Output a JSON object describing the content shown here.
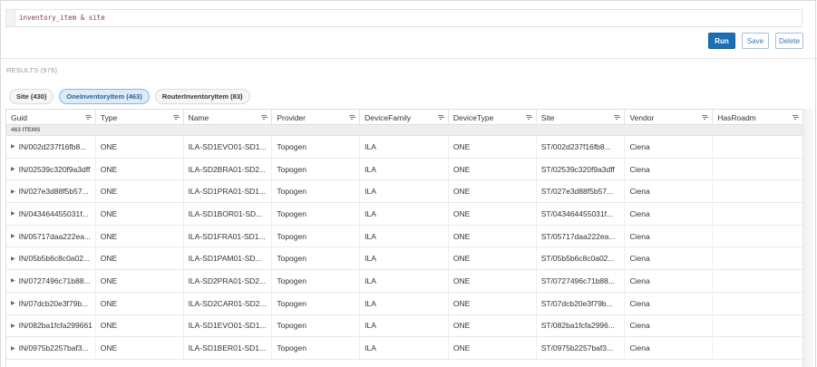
{
  "query": {
    "text": "inventory_item & site"
  },
  "buttons": {
    "run": "Run",
    "save": "Save",
    "delete": "Delete"
  },
  "results_label": "RESULTS (976)",
  "tabs": [
    {
      "label": "Site (430)",
      "active": false
    },
    {
      "label": "OneInventoryItem (463)",
      "active": true
    },
    {
      "label": "RouterInventoryItem (83)",
      "active": false
    }
  ],
  "columns": [
    "Guid",
    "Type",
    "Name",
    "Provider",
    "DeviceFamily",
    "DeviceType",
    "Site",
    "Vendor",
    "HasRoadm"
  ],
  "group_label": "463 ITEMS",
  "rows": [
    [
      "IN/002d237f16fb8...",
      "ONE",
      "ILA-SD1EVO01-SD1...",
      "Topogen",
      "ILA",
      "ONE",
      "ST/002d237f16fb8...",
      "Ciena",
      ""
    ],
    [
      "IN/02539c320f9a3dff",
      "ONE",
      "ILA-SD2BRA01-SD2...",
      "Topogen",
      "ILA",
      "ONE",
      "ST/02539c320f9a3dff",
      "Ciena",
      ""
    ],
    [
      "IN/027e3d88f5b57...",
      "ONE",
      "ILA-SD1PRA01-SD1...",
      "Topogen",
      "ILA",
      "ONE",
      "ST/027e3d88f5b57...",
      "Ciena",
      ""
    ],
    [
      "IN/043464455031f...",
      "ONE",
      "ILA-SD1BOR01-SD...",
      "Topogen",
      "ILA",
      "ONE",
      "ST/043464455031f...",
      "Ciena",
      ""
    ],
    [
      "IN/05717daa222ea...",
      "ONE",
      "ILA-SD1FRA01-SD1...",
      "Topogen",
      "ILA",
      "ONE",
      "ST/05717daa222ea...",
      "Ciena",
      ""
    ],
    [
      "IN/05b5b6c8c0a02...",
      "ONE",
      "ILA-SD1PAM01-SD...",
      "Topogen",
      "ILA",
      "ONE",
      "ST/05b5b6c8c0a02...",
      "Ciena",
      ""
    ],
    [
      "IN/0727496c71b88...",
      "ONE",
      "ILA-SD2PRA01-SD2...",
      "Topogen",
      "ILA",
      "ONE",
      "ST/0727496c71b88...",
      "Ciena",
      ""
    ],
    [
      "IN/07dcb20e3f79b...",
      "ONE",
      "ILA-SD2CAR01-SD2...",
      "Topogen",
      "ILA",
      "ONE",
      "ST/07dcb20e3f79b...",
      "Ciena",
      ""
    ],
    [
      "IN/082ba1fcfa299661",
      "ONE",
      "ILA-SD1EVO01-SD1...",
      "Topogen",
      "ILA",
      "ONE",
      "ST/082ba1fcfa2996...",
      "Ciena",
      ""
    ],
    [
      "IN/0975b2257baf3...",
      "ONE",
      "ILA-SD1BER01-SD1...",
      "Topogen",
      "ILA",
      "ONE",
      "ST/0975b2257baf3...",
      "Ciena",
      ""
    ]
  ]
}
